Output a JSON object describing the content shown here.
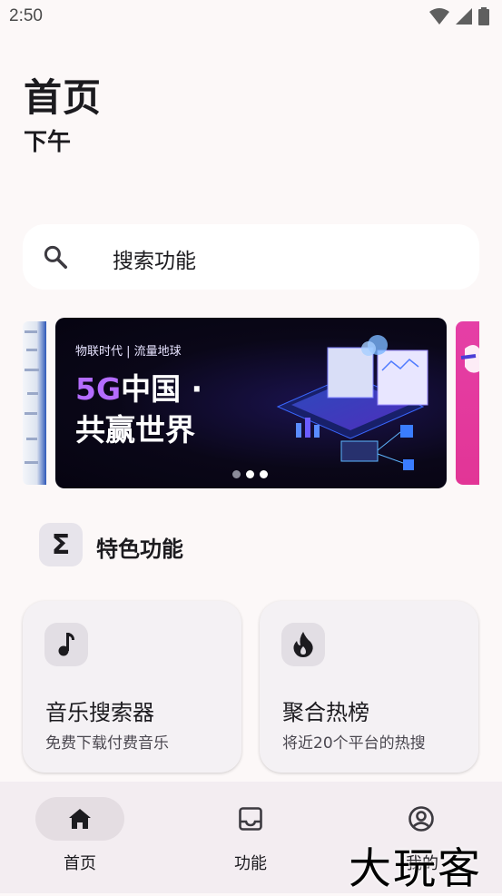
{
  "status_bar": {
    "time": "2:50",
    "icons": [
      "wifi-icon",
      "signal-icon",
      "battery-icon"
    ]
  },
  "header": {
    "title": "首页",
    "subtitle": "下午"
  },
  "search": {
    "label": "搜索功能",
    "icon": "search-icon"
  },
  "banner": {
    "tagline": "物联时代 | 流量地球",
    "headline_prefix": "5G",
    "headline_cn": "中国 ·",
    "headline_line2": "共赢世界",
    "dots_total": 3,
    "dots_active_index": 1
  },
  "section": {
    "icon": "sigma-icon",
    "icon_glyph": "Σ",
    "title": "特色功能"
  },
  "cards": [
    {
      "title": "音乐搜索器",
      "desc": "免费下载付费音乐",
      "icon": "music-note-icon"
    },
    {
      "title": "聚合热榜",
      "desc": "将近20个平台的热搜",
      "icon": "fire-icon"
    }
  ],
  "bottom_nav": {
    "items": [
      {
        "label": "首页",
        "icon": "home-icon",
        "selected": true
      },
      {
        "label": "功能",
        "icon": "inbox-icon",
        "selected": false
      },
      {
        "label": "我的",
        "icon": "account-circle-icon",
        "selected": false
      }
    ]
  },
  "watermark": "大玩客",
  "colors": {
    "background": "#FCF8F8",
    "nav_background": "#F3EDF1",
    "banner_accent": "#B46CFF"
  }
}
